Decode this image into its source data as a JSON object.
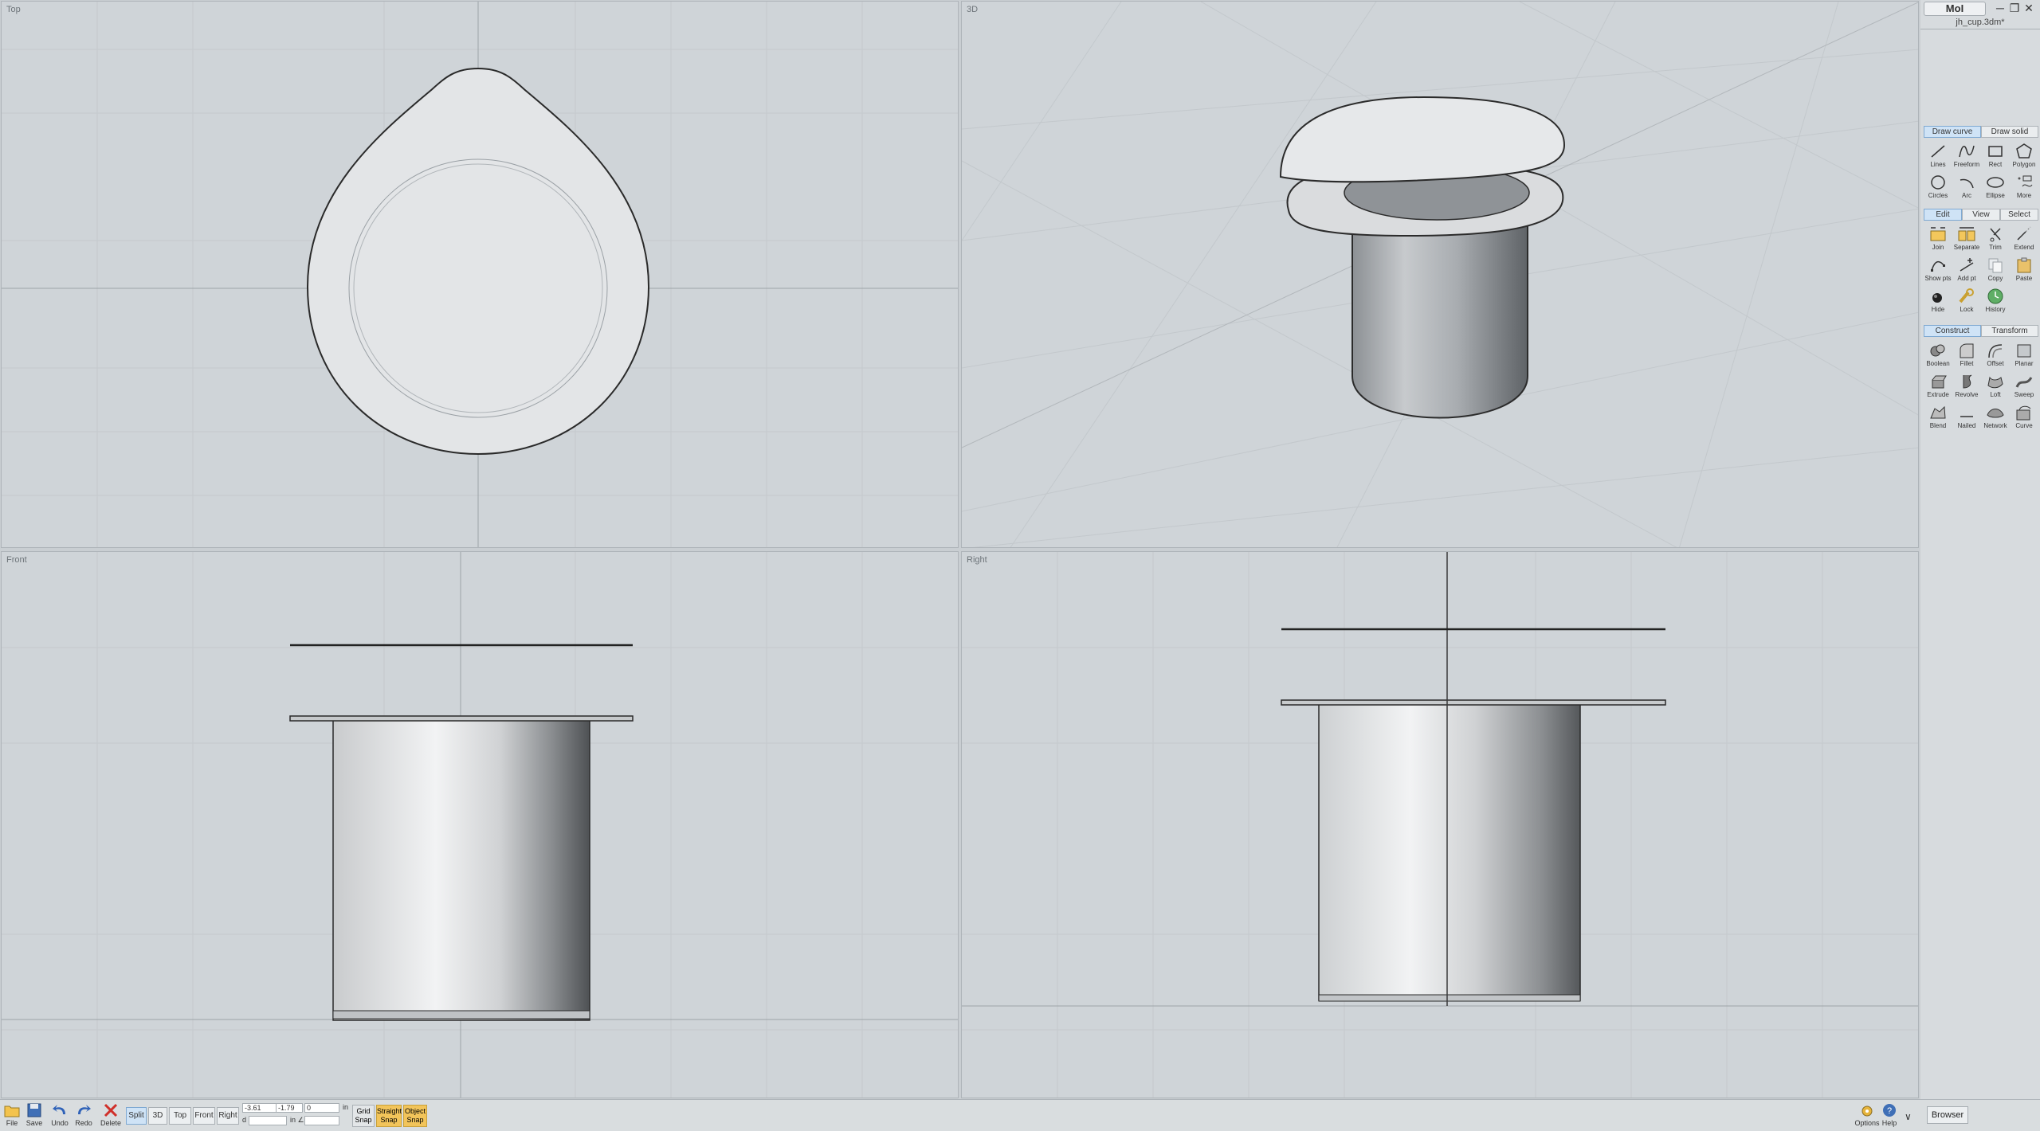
{
  "app": {
    "title": "MoI",
    "file_name": "jh_cup.3dm*"
  },
  "viewports": {
    "top": "Top",
    "three_d": "3D",
    "front": "Front",
    "right": "Right"
  },
  "draw_tabs": {
    "draw_curve": "Draw curve",
    "draw_solid": "Draw solid"
  },
  "draw_tools": [
    "Lines",
    "Freeform",
    "Rect",
    "Polygon",
    "Circles",
    "Arc",
    "Ellipse",
    "More"
  ],
  "edit_tabs": {
    "edit": "Edit",
    "view": "View",
    "select": "Select"
  },
  "edit_tools": [
    "Join",
    "Separate",
    "Trim",
    "Extend",
    "Show pts",
    "Add pt",
    "Copy",
    "Paste",
    "Hide",
    "Lock",
    "History"
  ],
  "construct_tabs": {
    "construct": "Construct",
    "transform": "Transform"
  },
  "construct_tools": [
    "Boolean",
    "Fillet",
    "Offset",
    "Planar",
    "Extrude",
    "Revolve",
    "Loft",
    "Sweep",
    "Blend",
    "Nailed",
    "Network",
    "Curve"
  ],
  "bottom": {
    "file": "File",
    "save": "Save",
    "undo": "Undo",
    "redo": "Redo",
    "delete": "Delete",
    "view_split": "Split",
    "view_3d": "3D",
    "view_top": "Top",
    "view_front": "Front",
    "view_right": "Right",
    "coord_x": "-3.61",
    "coord_y": "-1.79",
    "coord_z": "0",
    "unit": "in",
    "dist_label": "d",
    "dist_unit": "in ∠",
    "grid_snap": "Grid Snap",
    "straight_snap": "Straight Snap",
    "object_snap": "Object Snap",
    "options": "Options",
    "help": "Help",
    "browser": "Browser"
  }
}
